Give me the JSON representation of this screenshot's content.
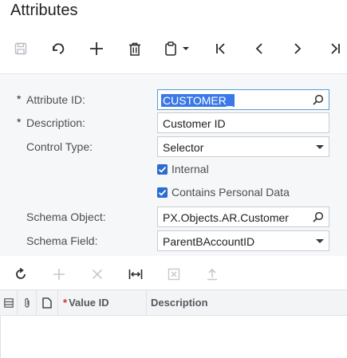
{
  "page": {
    "title": "Attributes"
  },
  "toolbar": {
    "buttons": [
      {
        "name": "save-button",
        "icon": "save-icon",
        "enabled": false
      },
      {
        "name": "undo-button",
        "icon": "undo-icon",
        "enabled": true
      },
      {
        "name": "add-button",
        "icon": "plus-icon",
        "enabled": true
      },
      {
        "name": "delete-button",
        "icon": "trash-icon",
        "enabled": true
      },
      {
        "name": "clipboard-button",
        "icon": "clipboard-dropdown-icon",
        "enabled": true
      },
      {
        "name": "first-record-button",
        "icon": "first-icon",
        "enabled": true
      },
      {
        "name": "previous-record-button",
        "icon": "prev-icon",
        "enabled": true
      },
      {
        "name": "next-record-button",
        "icon": "next-icon",
        "enabled": true
      },
      {
        "name": "last-record-button",
        "icon": "last-icon",
        "enabled": true
      }
    ]
  },
  "form": {
    "attribute_id": {
      "label": "Attribute ID:",
      "required": "*",
      "value": "CUSTOMER_",
      "icon": "search-icon"
    },
    "description": {
      "label": "Description:",
      "required": "*",
      "value": "Customer ID"
    },
    "control_type": {
      "label": "Control Type:",
      "value": "Selector",
      "icon": "dropdown-icon"
    },
    "internal": {
      "label": "Internal",
      "checked": true
    },
    "contains_personal_data": {
      "label": "Contains Personal Data",
      "checked": true
    },
    "schema_object": {
      "label": "Schema Object:",
      "value": "PX.Objects.AR.Customer",
      "icon": "search-icon"
    },
    "schema_field": {
      "label": "Schema Field:",
      "value": "ParentBAccountID",
      "icon": "dropdown-icon"
    }
  },
  "grid": {
    "toolbar": [
      {
        "name": "refresh-button",
        "icon": "refresh-icon",
        "enabled": true
      },
      {
        "name": "add-row-button",
        "icon": "plus-icon",
        "enabled": false
      },
      {
        "name": "delete-row-button",
        "icon": "close-icon",
        "enabled": false
      },
      {
        "name": "fit-columns-button",
        "icon": "fit-width-icon",
        "enabled": true
      },
      {
        "name": "export-excel-button",
        "icon": "excel-icon",
        "enabled": false
      },
      {
        "name": "upload-button",
        "icon": "upload-icon",
        "enabled": false
      }
    ],
    "columns": [
      {
        "name": "row-selector-col",
        "icon": "row-selector-icon"
      },
      {
        "name": "files-col",
        "icon": "paperclip-icon"
      },
      {
        "name": "notes-col",
        "icon": "note-icon"
      },
      {
        "name": "value-id-col",
        "label": "Value ID",
        "required": "*"
      },
      {
        "name": "description-col",
        "label": "Description"
      }
    ],
    "rows": []
  },
  "colors": {
    "accent": "#2a6ccf",
    "selection": "#3b78e7",
    "form_bg": "#f6f7f8",
    "disabled": "#b8bdc3"
  }
}
